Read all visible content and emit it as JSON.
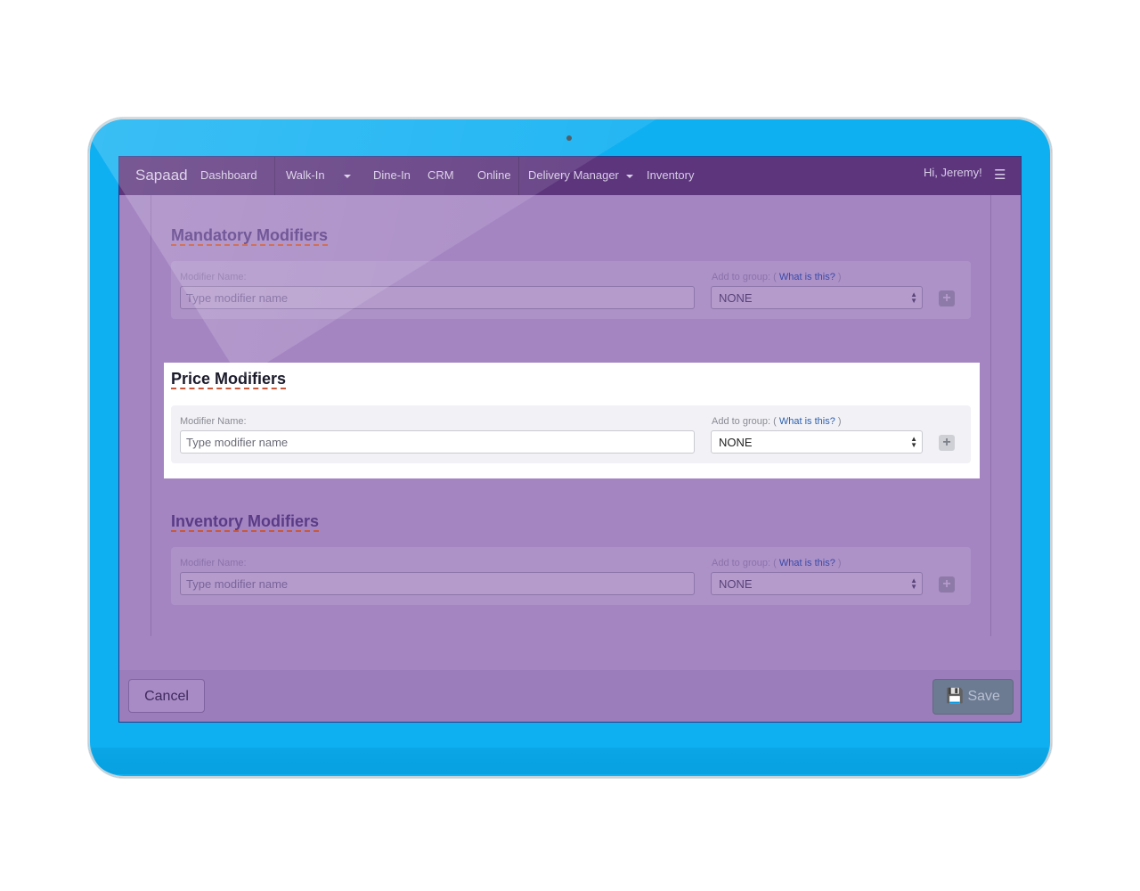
{
  "navbar": {
    "brand": "Sapaad",
    "items": [
      "Dashboard",
      "Walk-In",
      "Dine-In",
      "CRM",
      "Online",
      "Delivery Manager",
      "Inventory"
    ],
    "greeting": "Hi, Jeremy!",
    "menu_icon": "hamburger-icon"
  },
  "sections": [
    {
      "title": "Mandatory Modifiers",
      "name_label": "Modifier Name:",
      "name_placeholder": "Type modifier name",
      "group_label_prefix": "Add to group: (",
      "group_link": "What is this?",
      "group_label_suffix": ")",
      "group_value": "NONE"
    },
    {
      "title": "Price Modifiers",
      "name_label": "Modifier Name:",
      "name_placeholder": "Type modifier name",
      "group_label_prefix": "Add to group: (",
      "group_link": "What is this?",
      "group_label_suffix": ")",
      "group_value": "NONE"
    },
    {
      "title": "Inventory Modifiers",
      "name_label": "Modifier Name:",
      "name_placeholder": "Type modifier name",
      "group_label_prefix": "Add to group: (",
      "group_link": "What is this?",
      "group_label_suffix": ")",
      "group_value": "NONE"
    }
  ],
  "footer": {
    "cancel_label": "Cancel",
    "save_label": "Save",
    "save_icon": "floppy-disk-icon"
  },
  "colors": {
    "tablet_frame": "#0fb0f2",
    "navbar": "#5c357d",
    "overlay": "#a485c2",
    "highlight": "#ffffff"
  }
}
